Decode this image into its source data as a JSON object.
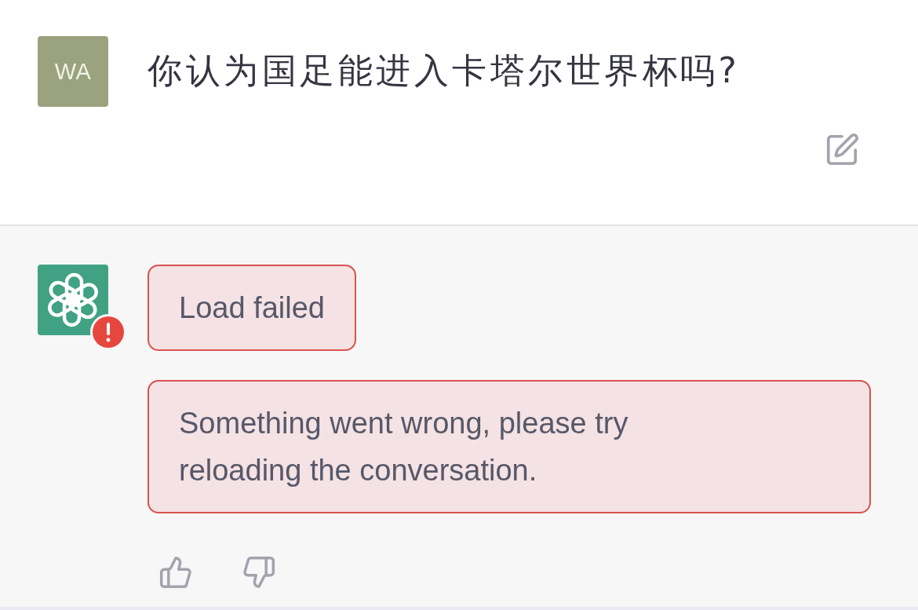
{
  "user_message": {
    "avatar_initials": "WA",
    "text": "你认为国足能进入卡塔尔世界杯吗?"
  },
  "assistant_message": {
    "error": true,
    "errors": [
      "Load failed",
      "Something went wrong, please try reloading the conversation."
    ]
  }
}
